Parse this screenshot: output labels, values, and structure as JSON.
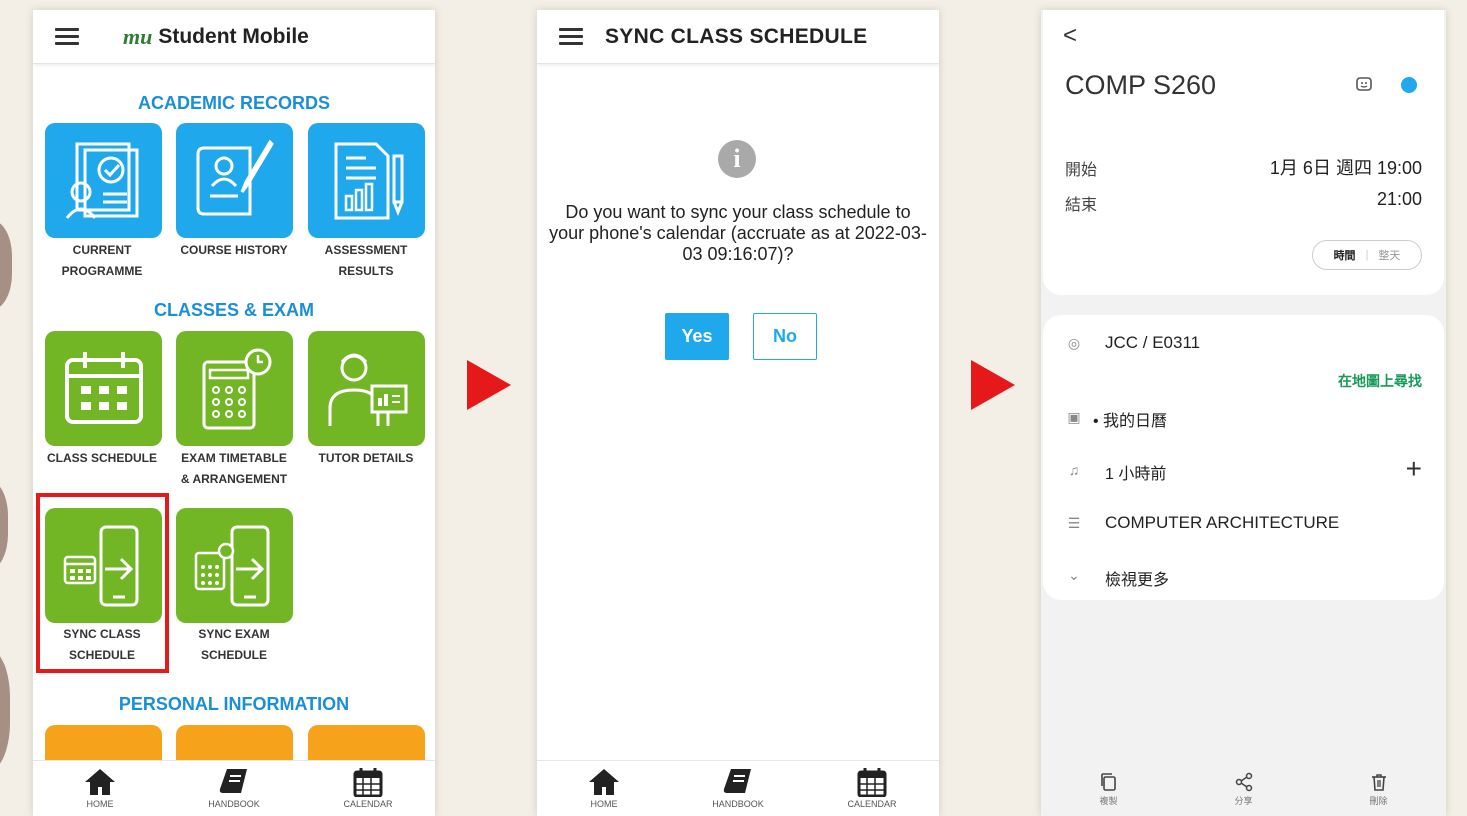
{
  "screen1": {
    "logo": "mu",
    "title": "Student Mobile",
    "sections": {
      "academic": "ACADEMIC RECORDS",
      "classes": "CLASSES & EXAM",
      "personal": "PERSONAL INFORMATION"
    },
    "tiles": {
      "current_programme": [
        "CURRENT",
        "PROGRAMME"
      ],
      "course_history": [
        "COURSE HISTORY"
      ],
      "assessment_results": [
        "ASSESSMENT",
        "RESULTS"
      ],
      "class_schedule": [
        "CLASS SCHEDULE"
      ],
      "exam_timetable": [
        "EXAM TIMETABLE",
        "& ARRANGEMENT"
      ],
      "tutor_details": [
        "TUTOR DETAILS"
      ],
      "sync_class": [
        "SYNC CLASS",
        "SCHEDULE"
      ],
      "sync_exam": [
        "SYNC EXAM",
        "SCHEDULE"
      ]
    },
    "nav": {
      "home": "HOME",
      "handbook": "HANDBOOK",
      "calendar": "CALENDAR"
    },
    "colors": {
      "blue": "#1fa8ec",
      "green": "#72b626",
      "orange": "#f7a21b",
      "highlight": "#e31b1b"
    }
  },
  "screen2": {
    "title": "SYNC CLASS SCHEDULE",
    "info_icon": "i",
    "message": "Do you want to sync your class schedule to your phone's calendar (accruate as at 2022-03-03 09:16:07)?",
    "yes": "Yes",
    "no": "No",
    "nav": {
      "home": "HOME",
      "handbook": "HANDBOOK",
      "calendar": "CALENDAR"
    }
  },
  "screen3": {
    "back": "<",
    "event_title": "COMP S260",
    "start_label": "開始",
    "start_value": "1月 6日 週四  19:00",
    "end_label": "結束",
    "end_value": "21:00",
    "toggle_time": "時間",
    "toggle_allday": "整天",
    "location": "JCC / E0311",
    "find_on_map": "在地圖上尋找",
    "calendar_name": "• 我的日曆",
    "reminder": "1 小時前",
    "description": "COMPUTER ARCHITECTURE",
    "view_more": "檢視更多",
    "nav": {
      "copy": "複製",
      "share": "分享",
      "delete": "刪除"
    },
    "dot_color": "#1fa8ec",
    "map_link_color": "#169a57"
  }
}
